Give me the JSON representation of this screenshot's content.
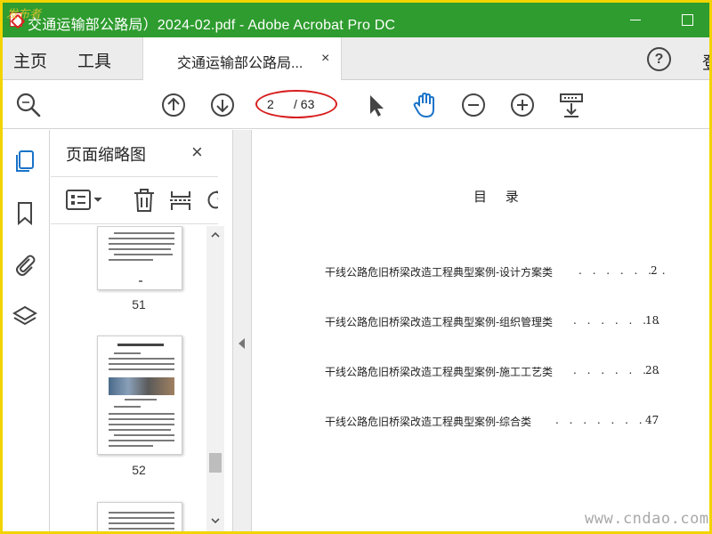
{
  "window": {
    "title": "交通运输部公路局）2024-02.pdf - Adobe Acrobat Pro DC",
    "watermark": "发布者"
  },
  "nav": {
    "home": "主页",
    "tools": "工具",
    "doc_tab_label": "交通运输部公路局...",
    "doc_tab_close": "×",
    "help": "?",
    "login": "登"
  },
  "toolbar": {
    "current_page": "2",
    "total_pages": "/ 63",
    "icons": [
      "zoom-search-icon",
      "page-up-icon",
      "page-down-icon",
      "select-arrow-icon",
      "hand-tool-icon",
      "zoom-out-icon",
      "zoom-in-icon",
      "scroll-mode-icon"
    ],
    "highlight_color": "#d81e1e"
  },
  "sidebar_rail": {
    "icons": [
      "page-thumbnails-icon",
      "bookmark-icon",
      "attachment-icon",
      "layers-icon"
    ]
  },
  "thumbnails_panel": {
    "title": "页面缩略图",
    "close": "×",
    "pages": [
      {
        "number": "51"
      },
      {
        "number": "52"
      }
    ]
  },
  "document": {
    "heading": "目 录",
    "toc": [
      {
        "title": "干线公路危旧桥梁改造工程典型案例-设计方案类",
        "dots": ". . . . . . .",
        "page": "2"
      },
      {
        "title": "干线公路危旧桥梁改造工程典型案例-组织管理类",
        "dots": ". . . . . . .",
        "page": "18"
      },
      {
        "title": "干线公路危旧桥梁改造工程典型案例-施工工艺类",
        "dots": ". . . . . . .",
        "page": "28"
      },
      {
        "title": "干线公路危旧桥梁改造工程典型案例-综合类",
        "dots": ". . . . . . . .",
        "page": "47"
      }
    ],
    "watermark": "www.cndao.com"
  },
  "colors": {
    "titlebar": "#2e9c2e",
    "hand_tool_active": "#1a73c8",
    "frame": "#f2d400"
  }
}
